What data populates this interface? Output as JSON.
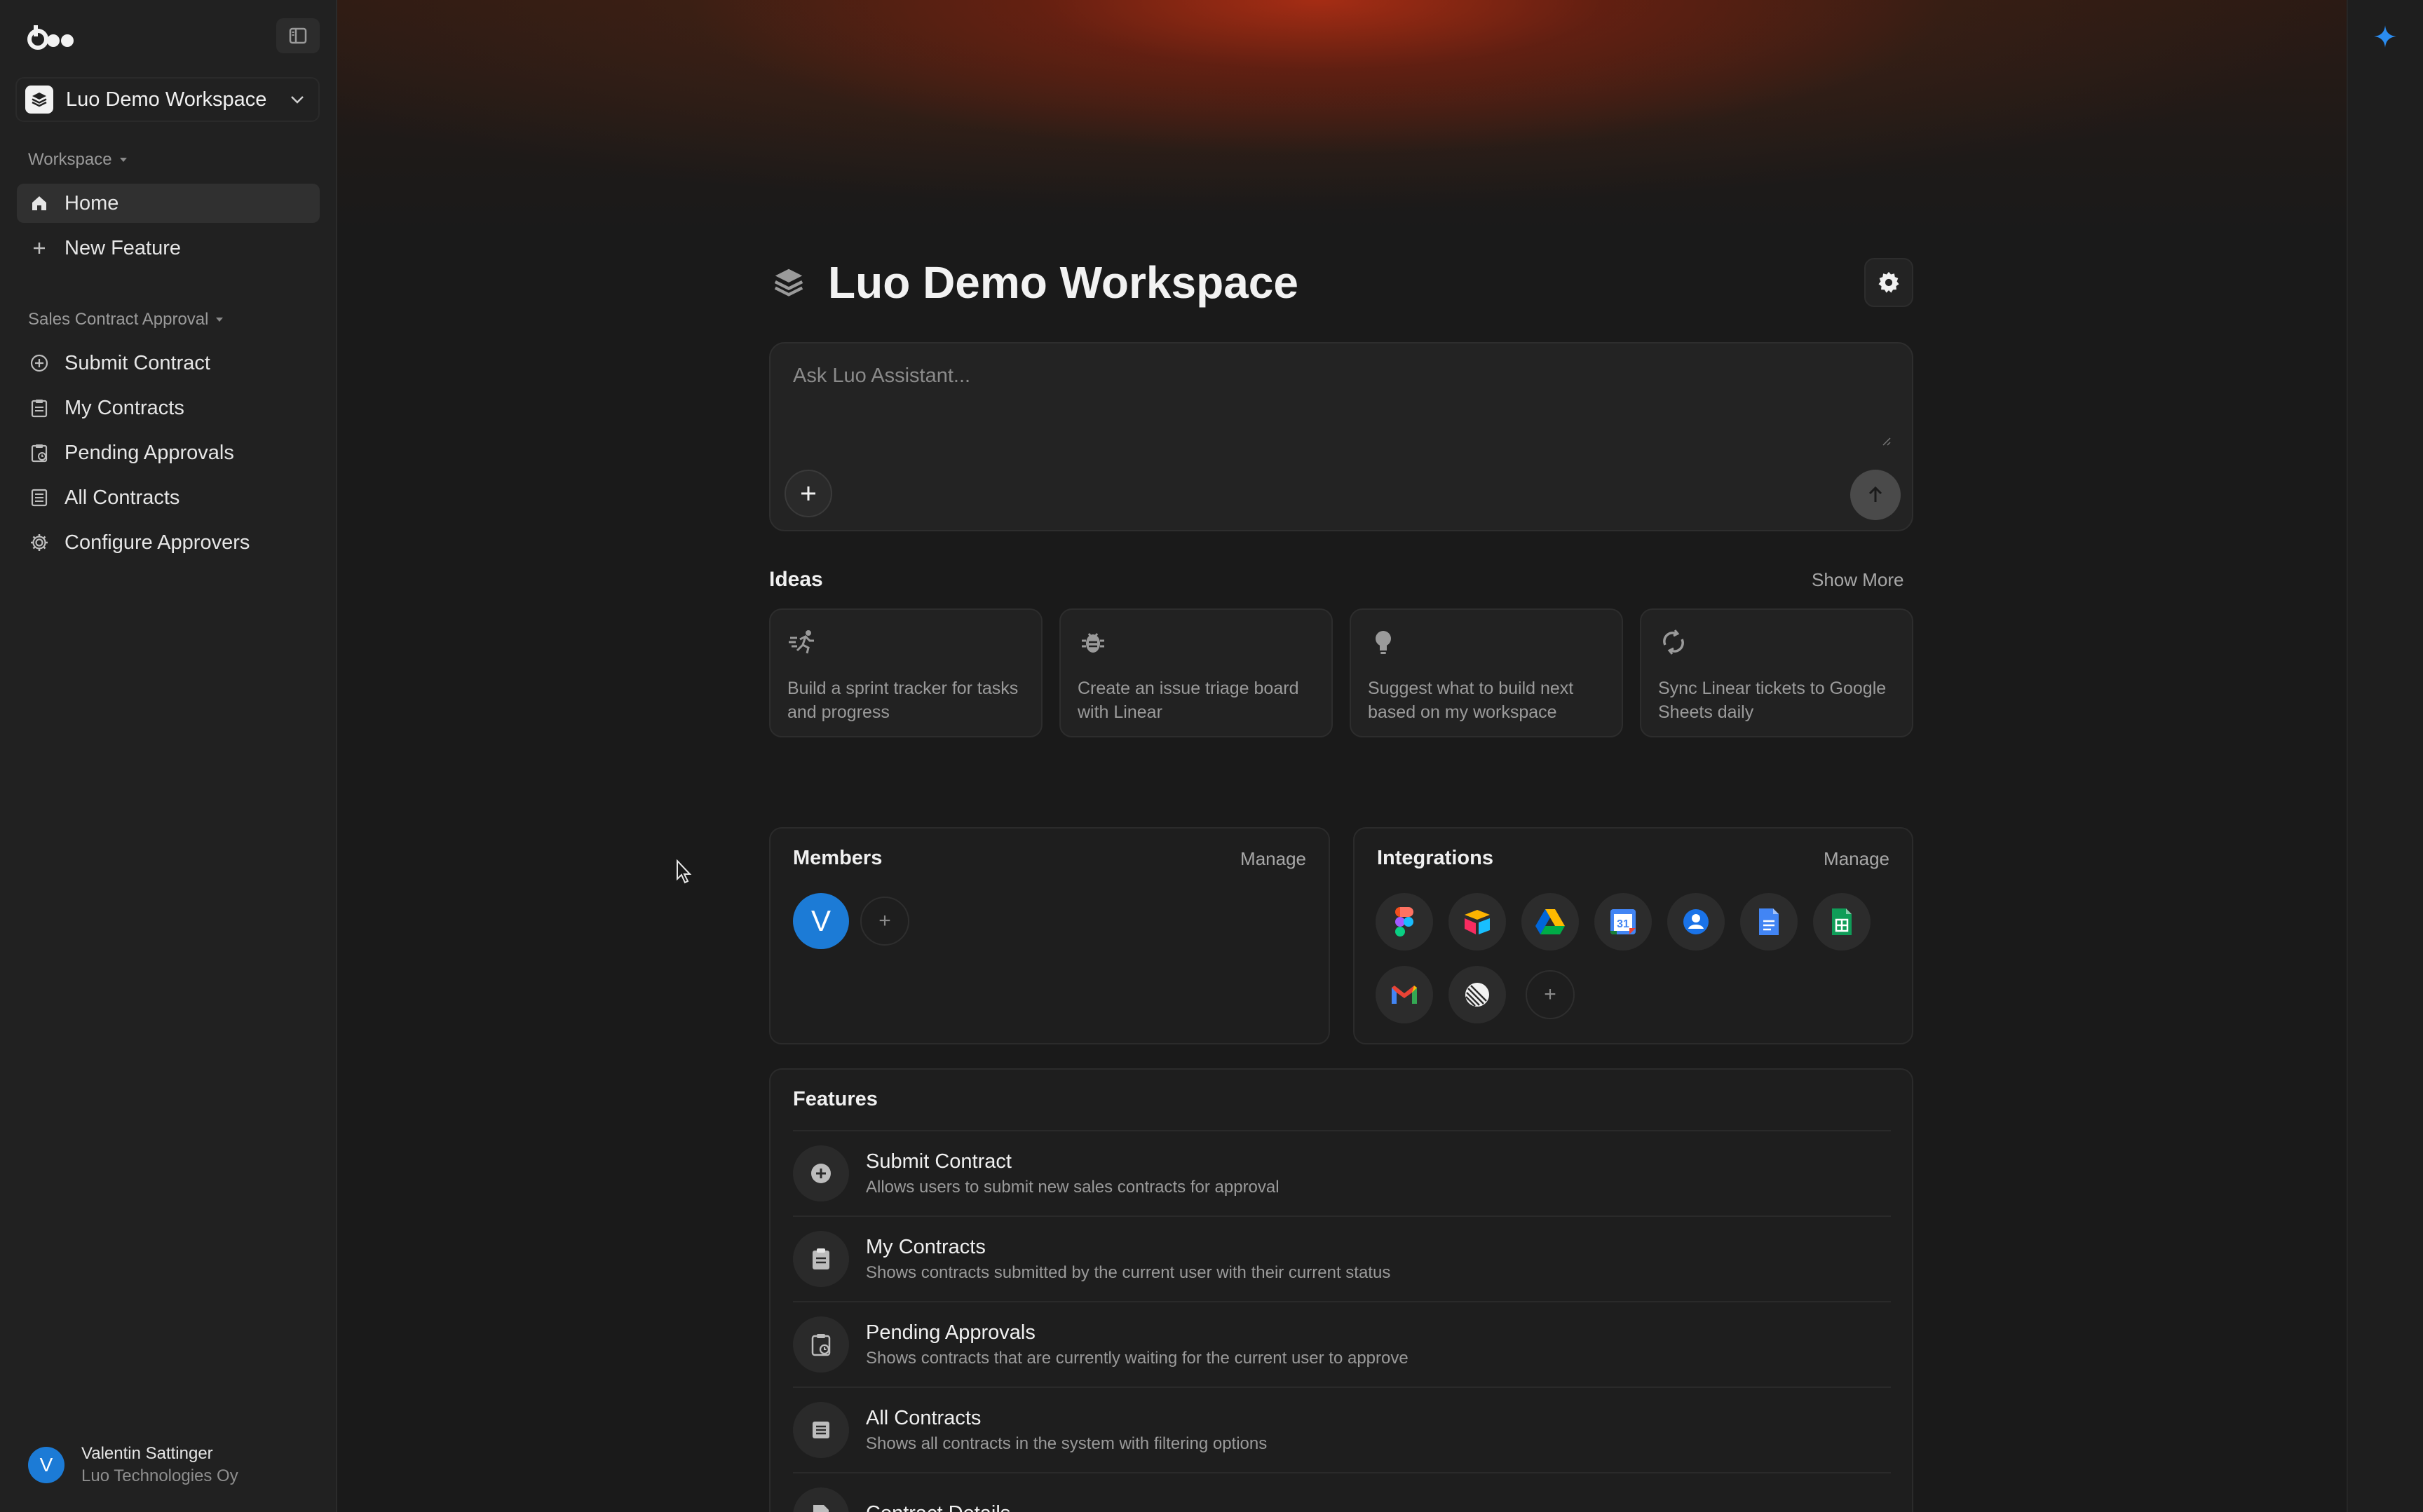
{
  "sidebar": {
    "workspace_name": "Luo Demo Workspace",
    "section_workspace": "Workspace",
    "workspace_items": [
      {
        "label": "Home",
        "icon": "home-icon"
      },
      {
        "label": "New Feature",
        "icon": "plus-icon"
      }
    ],
    "section_app": "Sales Contract Approval",
    "app_items": [
      {
        "label": "Submit Contract",
        "icon": "plus-circle-icon"
      },
      {
        "label": "My Contracts",
        "icon": "clipboard-icon"
      },
      {
        "label": "Pending Approvals",
        "icon": "clipboard-clock-icon"
      },
      {
        "label": "All Contracts",
        "icon": "list-icon"
      },
      {
        "label": "Configure Approvers",
        "icon": "gear-icon"
      }
    ],
    "user": {
      "initial": "V",
      "name": "Valentin Sattinger",
      "org": "Luo Technologies Oy"
    }
  },
  "main": {
    "title": "Luo Demo Workspace",
    "ask_placeholder": "Ask Luo Assistant...",
    "ideas_label": "Ideas",
    "show_more": "Show More",
    "ideas": [
      {
        "text": "Build a sprint tracker for tasks and progress",
        "icon": "runner-icon"
      },
      {
        "text": "Create an issue triage board with Linear",
        "icon": "bug-icon"
      },
      {
        "text": "Suggest what to build next based on my workspace",
        "icon": "lightbulb-icon"
      },
      {
        "text": "Sync Linear tickets to Google Sheets daily",
        "icon": "sync-icon"
      }
    ],
    "members": {
      "title": "Members",
      "manage": "Manage",
      "member_initial": "V",
      "add": "+"
    },
    "integrations": {
      "title": "Integrations",
      "manage": "Manage",
      "items": [
        "figma-icon",
        "airtable-icon",
        "google-drive-icon",
        "google-calendar-icon",
        "google-contacts-icon",
        "google-docs-icon",
        "google-sheets-icon",
        "gmail-icon",
        "linear-icon"
      ],
      "add": "+",
      "calendar_day": "31"
    },
    "features": {
      "title": "Features",
      "items": [
        {
          "name": "Submit Contract",
          "desc": "Allows users to submit new sales contracts for approval"
        },
        {
          "name": "My Contracts",
          "desc": "Shows contracts submitted by the current user with their current status"
        },
        {
          "name": "Pending Approvals",
          "desc": "Shows contracts that are currently waiting for the current user to approve"
        },
        {
          "name": "All Contracts",
          "desc": "Shows all contracts in the system with filtering options"
        },
        {
          "name": "Contract Details",
          "desc": ""
        }
      ]
    }
  },
  "colors": {
    "accent_blue": "#1c7bd6",
    "background": "#1a1a1a",
    "sidebar": "#212121",
    "sparkle": "#2a8cf0"
  }
}
